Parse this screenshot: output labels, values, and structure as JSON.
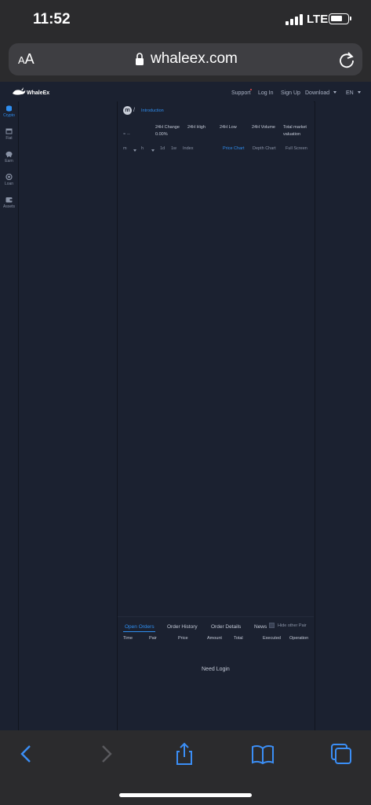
{
  "ios": {
    "time": "11:52",
    "network": "LTE",
    "text_size_label_small": "A",
    "text_size_label_large": "A",
    "url": "whaleex.com"
  },
  "site": {
    "brand": "WhaleEx",
    "nav": {
      "support": "Support",
      "login": "Log In",
      "signup": "Sign Up",
      "download": "Download",
      "language": "EN"
    },
    "sidebar": [
      {
        "label": "Crypto",
        "icon": "coins-icon",
        "active": true
      },
      {
        "label": "Fiat",
        "icon": "calendar-icon",
        "active": false
      },
      {
        "label": "Earn",
        "icon": "piggy-bank-icon",
        "active": false
      },
      {
        "label": "Loan",
        "icon": "loan-icon",
        "active": false
      },
      {
        "label": "Assets",
        "icon": "wallet-icon",
        "active": false
      }
    ],
    "market": {
      "coin_glyph": "m",
      "breadcrumb_sep": "/",
      "introduction": "Introduction",
      "price": "--",
      "price_arrow": "≈",
      "headers": [
        "24H Change",
        "24H High",
        "24H Low",
        "24H Volume",
        "Total market"
      ],
      "total_market_line2": "valuation",
      "change_value": "0.00%",
      "chart_intervals": [
        "m",
        "h",
        "1d",
        "1w",
        "Index"
      ],
      "chart_tabs": [
        "Price Chart",
        "Depth Chart",
        "Full Screen"
      ]
    },
    "orders": {
      "tabs": [
        "Open Orders",
        "Order History",
        "Order Details",
        "News"
      ],
      "hide_other": "Hide other Pair",
      "columns": [
        "Time",
        "Pair",
        "Price",
        "Amount",
        "Total",
        "Executed",
        "Operation"
      ],
      "empty_message": "Need Login"
    }
  },
  "colors": {
    "accent": "#2f8ef0",
    "background": "#1b2130",
    "ios_chrome": "#2b2b2d"
  }
}
